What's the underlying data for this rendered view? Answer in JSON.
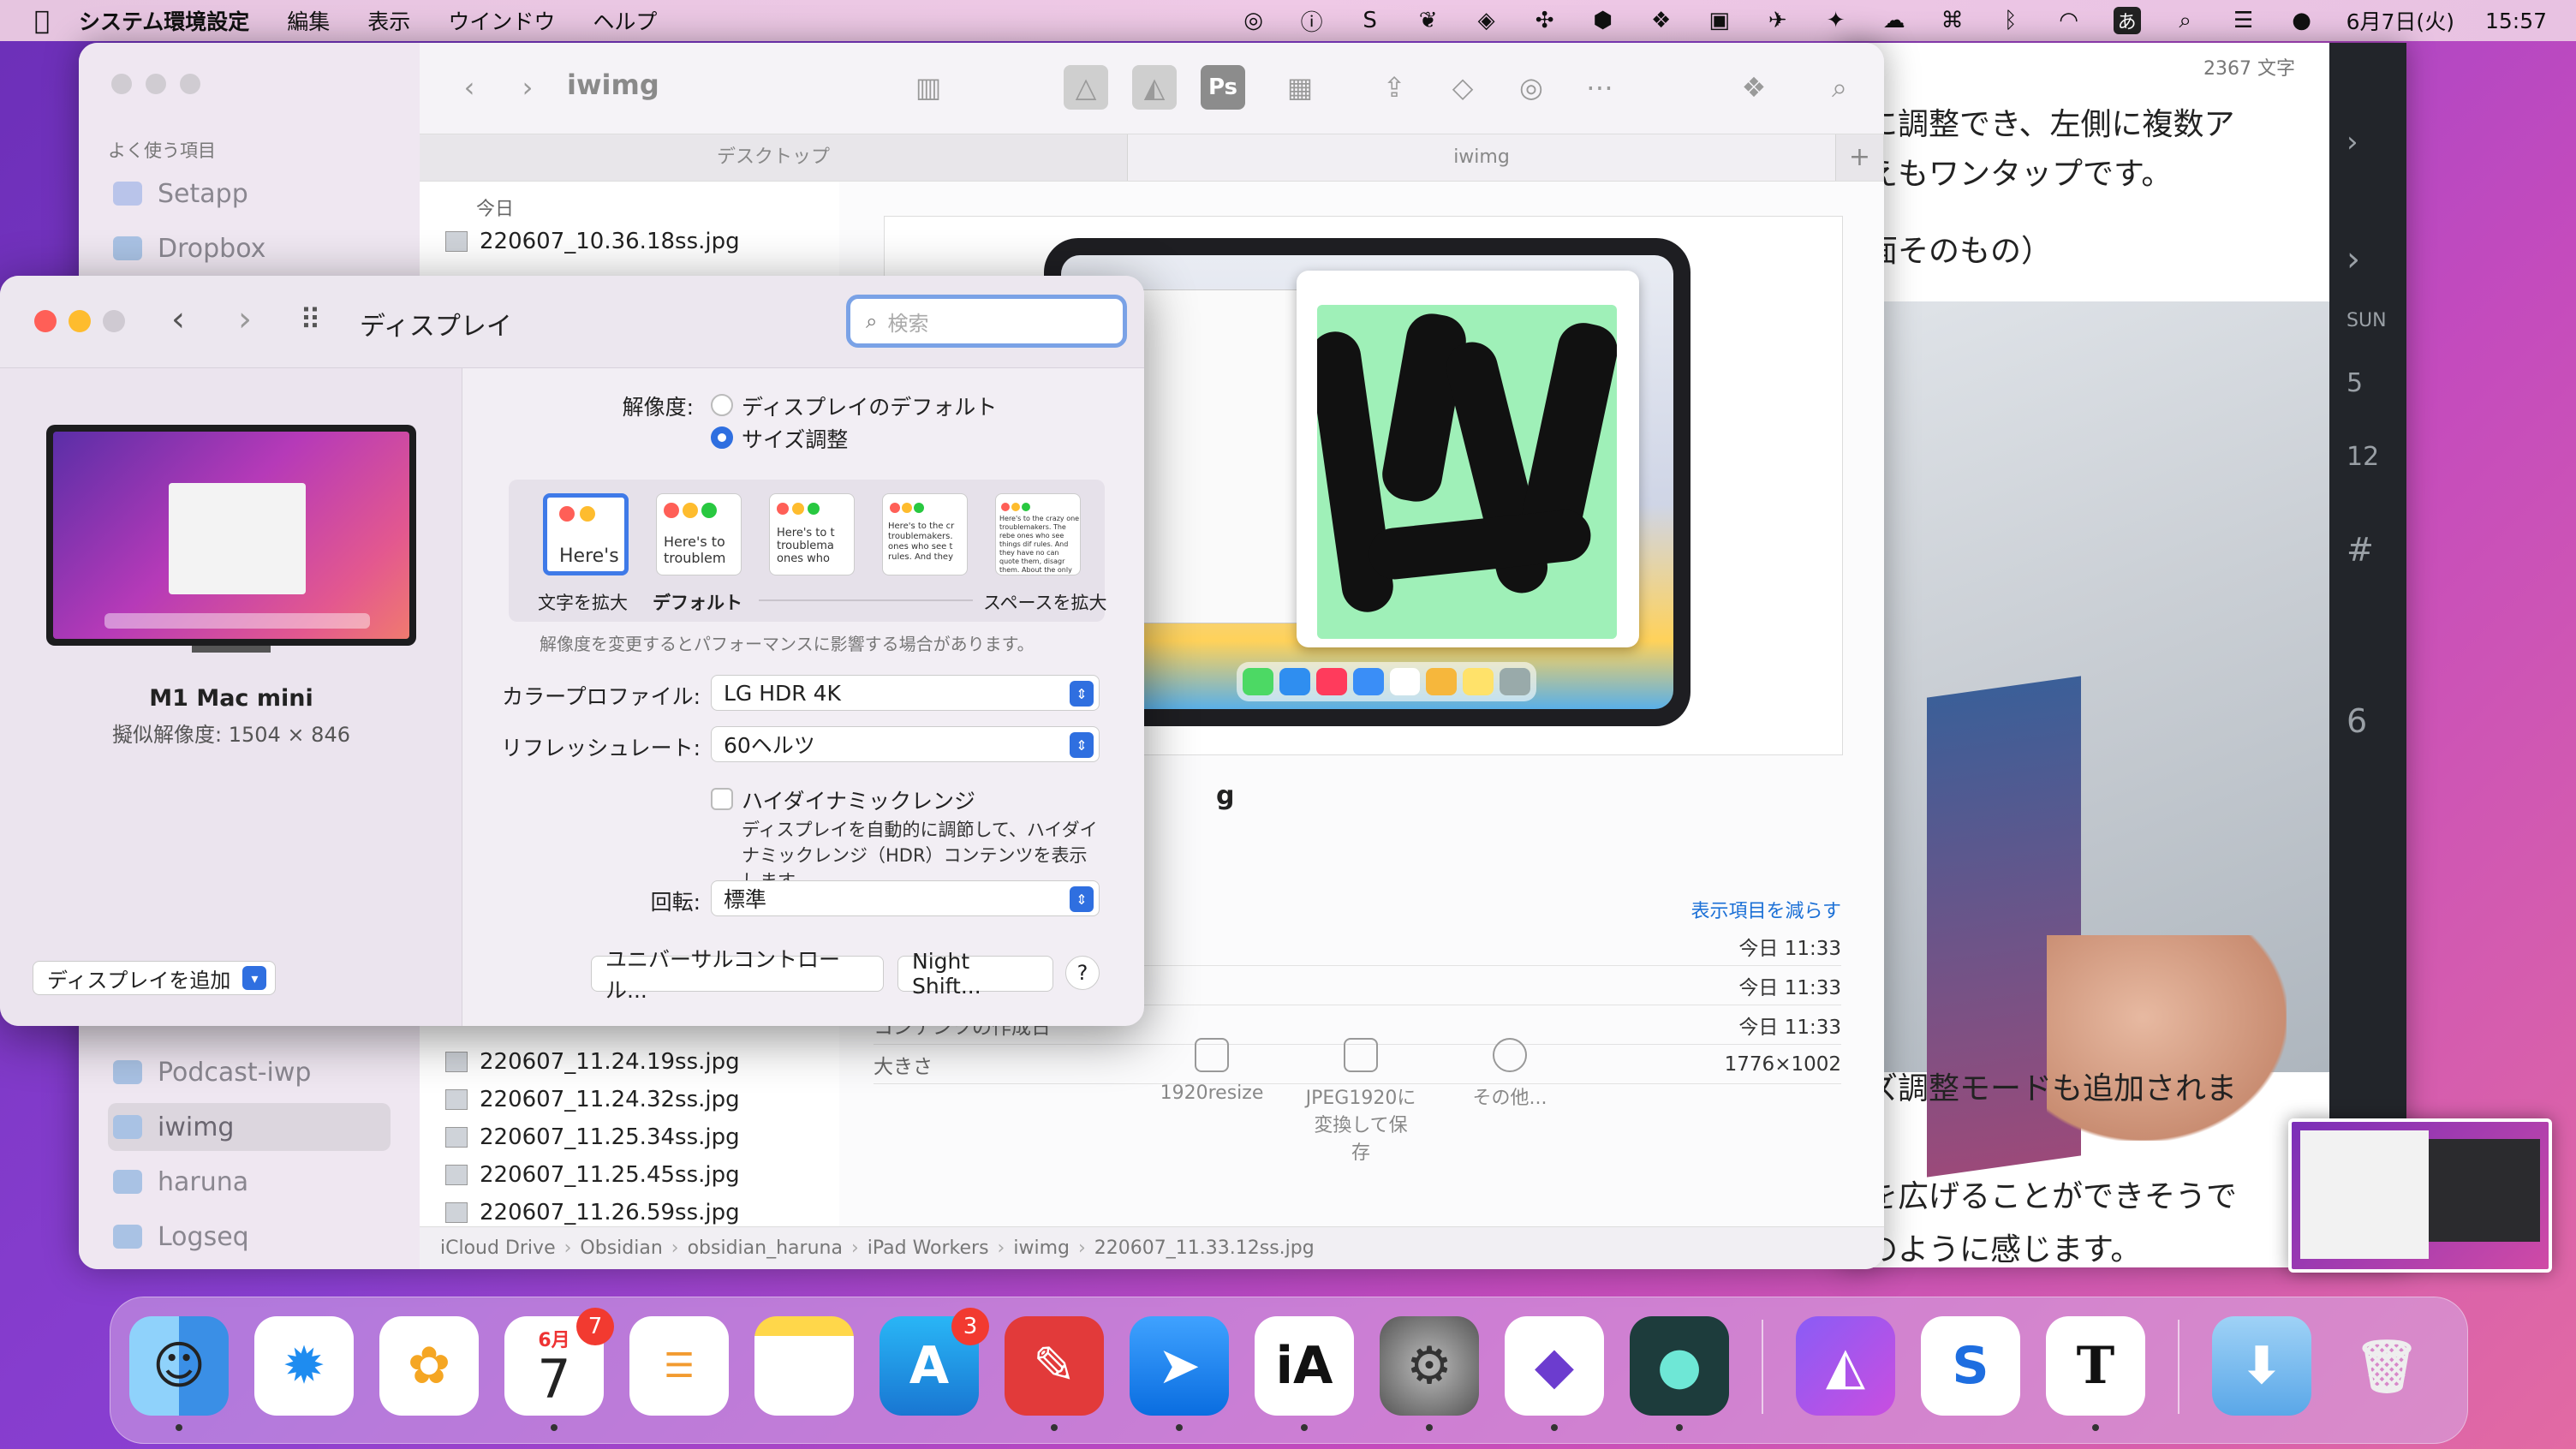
{
  "menubar": {
    "app_name": "システム環境設定",
    "items": [
      "編集",
      "表示",
      "ウインドウ",
      "ヘルプ"
    ],
    "date": "6月7日(火)",
    "time": "15:57",
    "input_mode": "あ"
  },
  "writer": {
    "word_count": "2367 文字",
    "lines": [
      "に調整でき、左側に複数ア",
      "えもワンタップです。",
      "面そのもの）",
      "ズ調整モードも追加されま",
      "を広げることができそうで",
      "のように感じます。"
    ],
    "side_labels": [
      "SUN",
      "5",
      "12",
      "#",
      "6"
    ]
  },
  "finder": {
    "title": "iwimg",
    "sidebar_header": "よく使う項目",
    "sidebar_items": [
      "Setapp",
      "Dropbox",
      "Podcast-iwp",
      "iwimg",
      "haruna",
      "Logseq"
    ],
    "tabs": [
      "デスクトップ",
      "iwimg"
    ],
    "list_header": "今日",
    "files_top": [
      "220607_10.36.18ss.jpg"
    ],
    "files_bottom": [
      "220607_11.24.19ss.jpg",
      "220607_11.24.32ss.jpg",
      "220607_11.25.34ss.jpg",
      "220607_11.25.45ss.jpg",
      "220607_11.26.59ss.jpg"
    ],
    "preview_label": "g",
    "show_less": "表示項目を減らす",
    "info": [
      {
        "k": "",
        "v": "今日 11:33"
      },
      {
        "k": "",
        "v": "今日 11:33"
      },
      {
        "k": "コンテンツの作成日",
        "v": "今日 11:33"
      },
      {
        "k": "大きさ",
        "v": "1776×1002"
      }
    ],
    "actions": [
      "1920resize",
      "JPEG1920に変換して保存",
      "その他..."
    ],
    "path": [
      "iCloud Drive",
      "Obsidian",
      "obsidian_haruna",
      "iPad Workers",
      "iwimg",
      "220607_11.33.12ss.jpg"
    ]
  },
  "prefs": {
    "title": "ディスプレイ",
    "search_placeholder": "検索",
    "monitor_name": "M1 Mac mini",
    "monitor_res": "擬似解像度: 1504 × 846",
    "add_display": "ディスプレイを追加",
    "resolution_label": "解像度:",
    "res_default": "ディスプレイのデフォルト",
    "res_scaled": "サイズ調整",
    "scale_options": [
      "Here's",
      "Here's to troublem",
      "Here's to t troublema ones who",
      "Here's to the cr troublemakers. ones who see t rules. And they",
      "Here's to the crazy one troublemakers. The rebe ones who see things dif rules. And they have no can quote them, disagr them. About the only th Because they change t"
    ],
    "scale_label_larger": "文字を拡大",
    "scale_label_default": "デフォルト",
    "scale_label_more_space": "スペースを拡大",
    "perf_note": "解像度を変更するとパフォーマンスに影響する場合があります。",
    "color_profile_label": "カラープロファイル:",
    "color_profile": "LG HDR 4K",
    "refresh_label": "リフレッシュレート:",
    "refresh": "60ヘルツ",
    "hdr_label": "ハイダイナミックレンジ",
    "hdr_desc": "ディスプレイを自動的に調節して、ハイダイナミックレンジ（HDR）コンテンツを表示します。",
    "rotation_label": "回転:",
    "rotation": "標準",
    "universal_control": "ユニバーサルコントロール...",
    "night_shift": "Night Shift...",
    "help": "?"
  },
  "dock": {
    "calendar_month": "6月",
    "calendar_day": "7",
    "calendar_badge": "7",
    "appstore_badge": "3",
    "ia_label": "iA",
    "t_label": "T"
  }
}
